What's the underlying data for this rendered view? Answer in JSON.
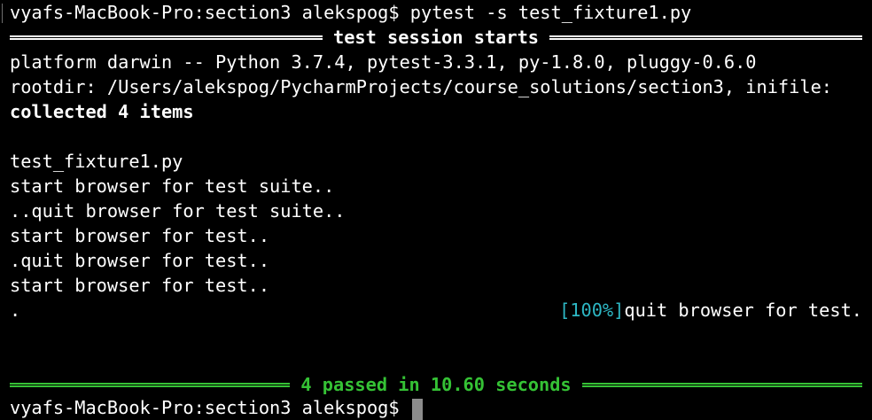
{
  "terminal": {
    "command_prompt": "vyafs-MacBook-Pro:section3 alekspog$ pytest -s test_fixture1.py",
    "session_header": "test session starts",
    "platform_line": "platform darwin -- Python 3.7.4, pytest-3.3.1, py-1.8.0, pluggy-0.6.0",
    "rootdir_line": "rootdir: /Users/alekspog/PycharmProjects/course_solutions/section3, inifile:",
    "collected_line": "collected 4 items",
    "output_lines": [
      "test_fixture1.py",
      "start browser for test suite..",
      "..quit browser for test suite..",
      "start browser for test..",
      ".quit browser for test..",
      "start browser for test.."
    ],
    "last_output": {
      "dot": ".",
      "progress": "[100%]",
      "text": "quit browser for test."
    },
    "summary": "4 passed in 10.60 seconds",
    "final_prompt": "vyafs-MacBook-Pro:section3 alekspog$ "
  },
  "colors": {
    "background": "#000000",
    "text": "#ffffff",
    "passed_green": "#35c235",
    "progress_cyan": "#2db7c4",
    "cursor": "#8c8c8c"
  }
}
